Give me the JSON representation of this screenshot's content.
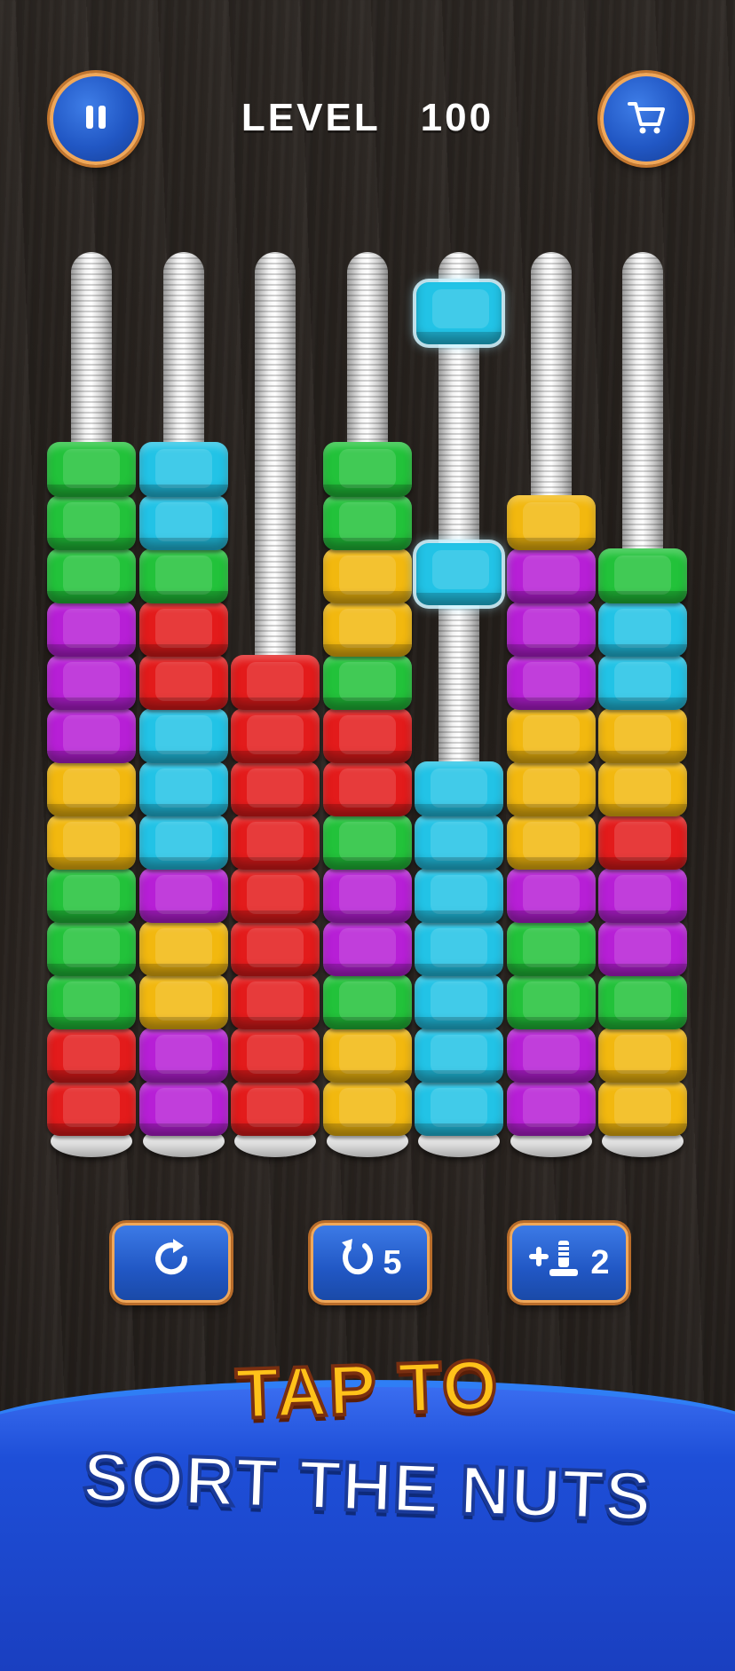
{
  "header": {
    "pause_icon": "pause-icon",
    "level_label": "LEVEL",
    "level_number": "100",
    "shop_icon": "cart-icon"
  },
  "colors": {
    "green": "#22c23a",
    "cyan": "#22c3e6",
    "red": "#e31b1b",
    "purple": "#b71fd6",
    "yellow": "#f2b80f",
    "accent_border": "#f0a85a",
    "button_blue": "#2157c4"
  },
  "board": {
    "columns": [
      [
        "red",
        "red",
        "green",
        "green",
        "green",
        "yellow",
        "yellow",
        "purple",
        "purple",
        "purple",
        "green",
        "green",
        "green"
      ],
      [
        "purple",
        "purple",
        "yellow",
        "yellow",
        "purple",
        "cyan",
        "cyan",
        "cyan",
        "red",
        "red",
        "green",
        "cyan",
        "cyan"
      ],
      [
        "red",
        "red",
        "red",
        "red",
        "red",
        "red",
        "red",
        "red",
        "red"
      ],
      [
        "yellow",
        "yellow",
        "green",
        "purple",
        "purple",
        "green",
        "red",
        "red",
        "green",
        "yellow",
        "yellow",
        "green",
        "green"
      ],
      [
        "cyan",
        "cyan",
        "cyan",
        "cyan",
        "cyan",
        "cyan",
        "cyan"
      ],
      [
        "purple",
        "purple",
        "green",
        "green",
        "purple",
        "yellow",
        "yellow",
        "yellow",
        "purple",
        "purple",
        "purple",
        "yellow"
      ],
      [
        "yellow",
        "yellow",
        "green",
        "purple",
        "purple",
        "red",
        "yellow",
        "yellow",
        "cyan",
        "cyan",
        "green"
      ]
    ],
    "lifted_nuts": [
      "cyan",
      "cyan"
    ]
  },
  "actions": {
    "restart_icon": "restart-icon",
    "undo_icon": "undo-icon",
    "undo_count": "5",
    "add_pole_icon": "add-pole-icon",
    "add_pole_count": "2"
  },
  "banner": {
    "line1": "TAP TO",
    "line2": "SORT THE NUTS"
  }
}
